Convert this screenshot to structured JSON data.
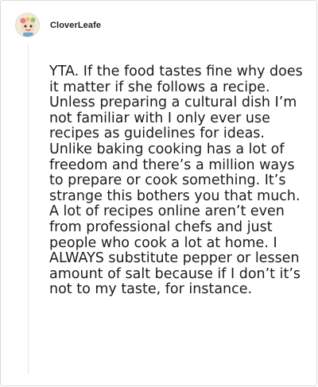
{
  "comment": {
    "username": "CloverLeafe",
    "avatar_icon": "cartoon-avatar-icon",
    "body": "YTA. If the food tastes fine why does it matter if she follows a recipe. Unless preparing a cultural dish I’m not familiar with I only ever use recipes as guidelines for ideas. Unlike baking cooking has a lot of freedom and there’s a million ways to prepare or cook something. It’s strange this bothers you that much. A lot of recipes online aren’t even from professional chefs and just people who cook a lot at home. I ALWAYS substitute pepper or lessen amount of salt because if I don’t it’s not to my taste, for instance."
  },
  "colors": {
    "border": "#dcdcdc",
    "text": "#1c1c1c",
    "thread_line": "#e4e4e4"
  }
}
